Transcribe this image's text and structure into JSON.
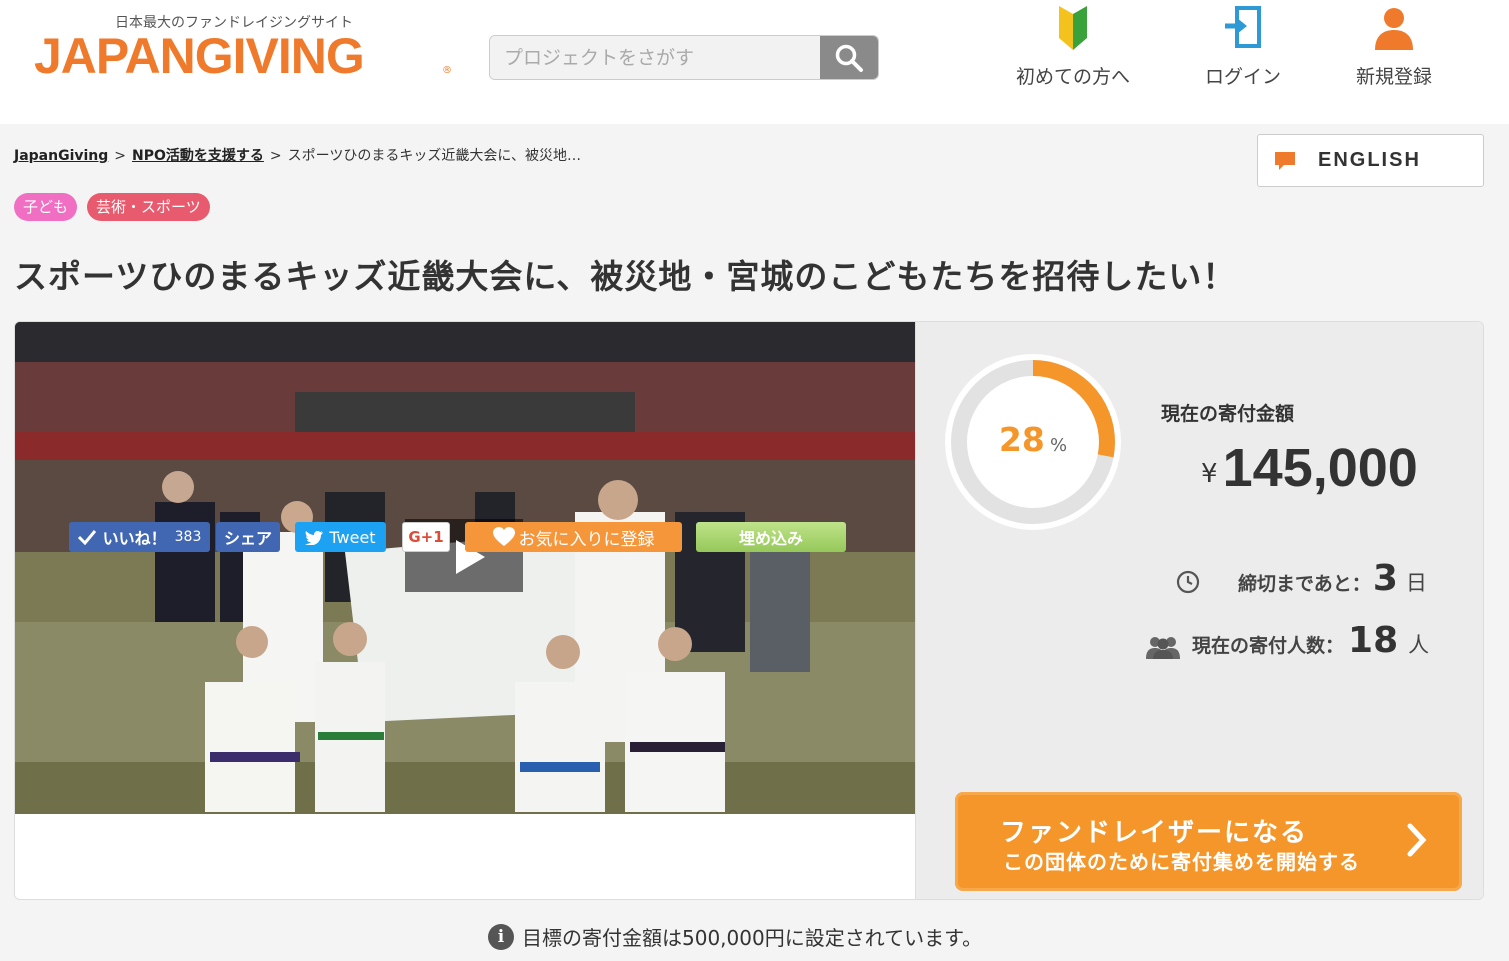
{
  "header": {
    "tagline": "日本最大のファンドレイジングサイト",
    "logo": "JAPANGIVING",
    "logo_mark": "®",
    "search_placeholder": "プロジェクトをさがす",
    "nav": [
      {
        "label": "初めての方へ",
        "icon": "beginner-leaf-icon"
      },
      {
        "label": "ログイン",
        "icon": "login-icon"
      },
      {
        "label": "新規登録",
        "icon": "user-register-icon"
      }
    ]
  },
  "breadcrumb": {
    "home": "JapanGiving",
    "category": "NPO活動を支援する",
    "current": "スポーツひのまるキッズ近畿大会に、被災地…",
    "separator": ">"
  },
  "language_button": "ENGLISH",
  "tags": [
    {
      "label": "子ども",
      "color": "#f06fc3"
    },
    {
      "label": "芸術・スポーツ",
      "color": "#e85b6e"
    }
  ],
  "title": "スポーツひのまるキッズ近畿大会に、被災地・宮城のこどもたちを招待したい！",
  "stats": {
    "progress_value": "28",
    "progress_unit": "%",
    "progress_fraction": 0.28,
    "amount_label": "現在の寄付金額",
    "currency": "¥",
    "amount": "145,000",
    "deadline_label": "締切まであと：",
    "deadline_value": "3",
    "deadline_unit": "日",
    "donors_label": "現在の寄付人数：",
    "donors_value": "18",
    "donors_unit": "人"
  },
  "cta": {
    "line1": "ファンドレイザーになる",
    "line2": "この団体のために寄付集めを開始する"
  },
  "share": {
    "like_label": "いいね！",
    "like_count": "383",
    "share_label": "シェア",
    "tweet_label": "Tweet",
    "gplus_label": "G+1",
    "favorite_label": "お気に入りに登録",
    "embed_label": "埋め込み"
  },
  "goal_text": "目標の寄付金額は500,000円に設定されています。",
  "colors": {
    "brand_orange": "#f07a2b",
    "cta_orange": "#f5962b",
    "facebook_blue": "#4267b2",
    "twitter_blue": "#1da1f2",
    "favorite_orange": "#f5963b",
    "embed_green": "#a6d36b"
  }
}
